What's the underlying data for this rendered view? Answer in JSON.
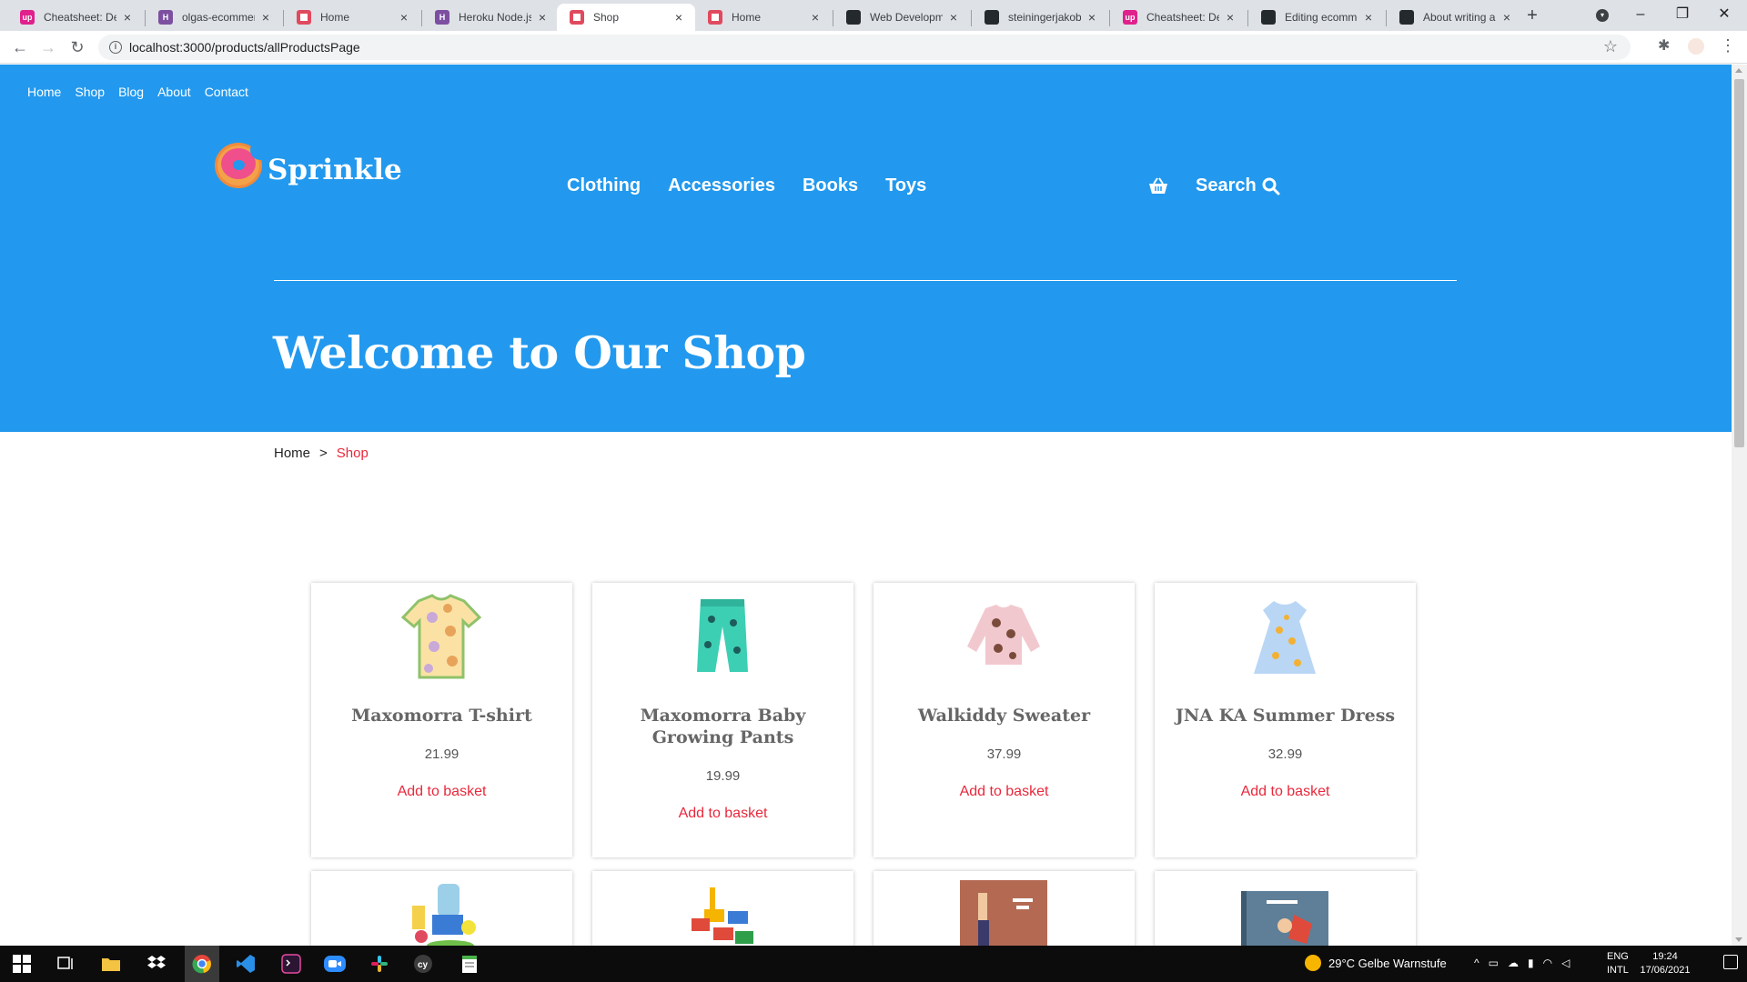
{
  "browser": {
    "tabs": [
      {
        "title": "Cheatsheet: Dep",
        "favicon": "upwork-icon",
        "active": false
      },
      {
        "title": "olgas-ecommerc",
        "favicon": "heroku-icon",
        "active": false
      },
      {
        "title": "Home",
        "favicon": "donut-icon",
        "active": false
      },
      {
        "title": "Heroku Node.js",
        "favicon": "heroku-icon",
        "active": false
      },
      {
        "title": "Shop",
        "favicon": "donut-icon",
        "active": true
      },
      {
        "title": "Home",
        "favicon": "donut-icon",
        "active": false
      },
      {
        "title": "Web Developme",
        "favicon": "github-icon",
        "active": false
      },
      {
        "title": "steiningerjakob",
        "favicon": "github-icon",
        "active": false
      },
      {
        "title": "Cheatsheet: Dep",
        "favicon": "upwork-icon",
        "active": false
      },
      {
        "title": "Editing ecomme",
        "favicon": "github-icon",
        "active": false
      },
      {
        "title": "About writing a",
        "favicon": "github-icon",
        "active": false
      }
    ],
    "new_tab_label": "+",
    "url": "localhost:3000/products/allProductsPage"
  },
  "site": {
    "topnav": [
      "Home",
      "Shop",
      "Blog",
      "About",
      "Contact"
    ],
    "logo_text": "Sprinkle",
    "mainnav": [
      "Clothing",
      "Accessories",
      "Books",
      "Toys"
    ],
    "search_label": "Search",
    "hero_title": "Welcome to Our Shop",
    "breadcrumb": {
      "home": "Home",
      "separator": ">",
      "current": "Shop"
    },
    "colors": {
      "hero_bg": "#2299ee",
      "accent": "#e8283b"
    }
  },
  "products": [
    {
      "name": "Maxomorra T-shirt",
      "price": "21.99",
      "cta": "Add to basket",
      "image": "t-shirt-image"
    },
    {
      "name": "Maxomorra Baby Growing Pants",
      "price": "19.99",
      "cta": "Add to basket",
      "image": "pants-image"
    },
    {
      "name": "Walkiddy Sweater",
      "price": "37.99",
      "cta": "Add to basket",
      "image": "sweater-image"
    },
    {
      "name": "JNA KA Summer Dress",
      "price": "32.99",
      "cta": "Add to basket",
      "image": "dress-image"
    }
  ],
  "products_row2": [
    {
      "image": "toy-kitchen-image"
    },
    {
      "image": "toy-animals-image"
    },
    {
      "image": "book-cover-image"
    },
    {
      "image": "book-cover-image"
    }
  ],
  "taskbar": {
    "weather": "29°C  Gelbe Warnstufe",
    "lang_top": "ENG",
    "lang_bottom": "INTL",
    "time": "19:24",
    "date": "17/06/2021"
  }
}
